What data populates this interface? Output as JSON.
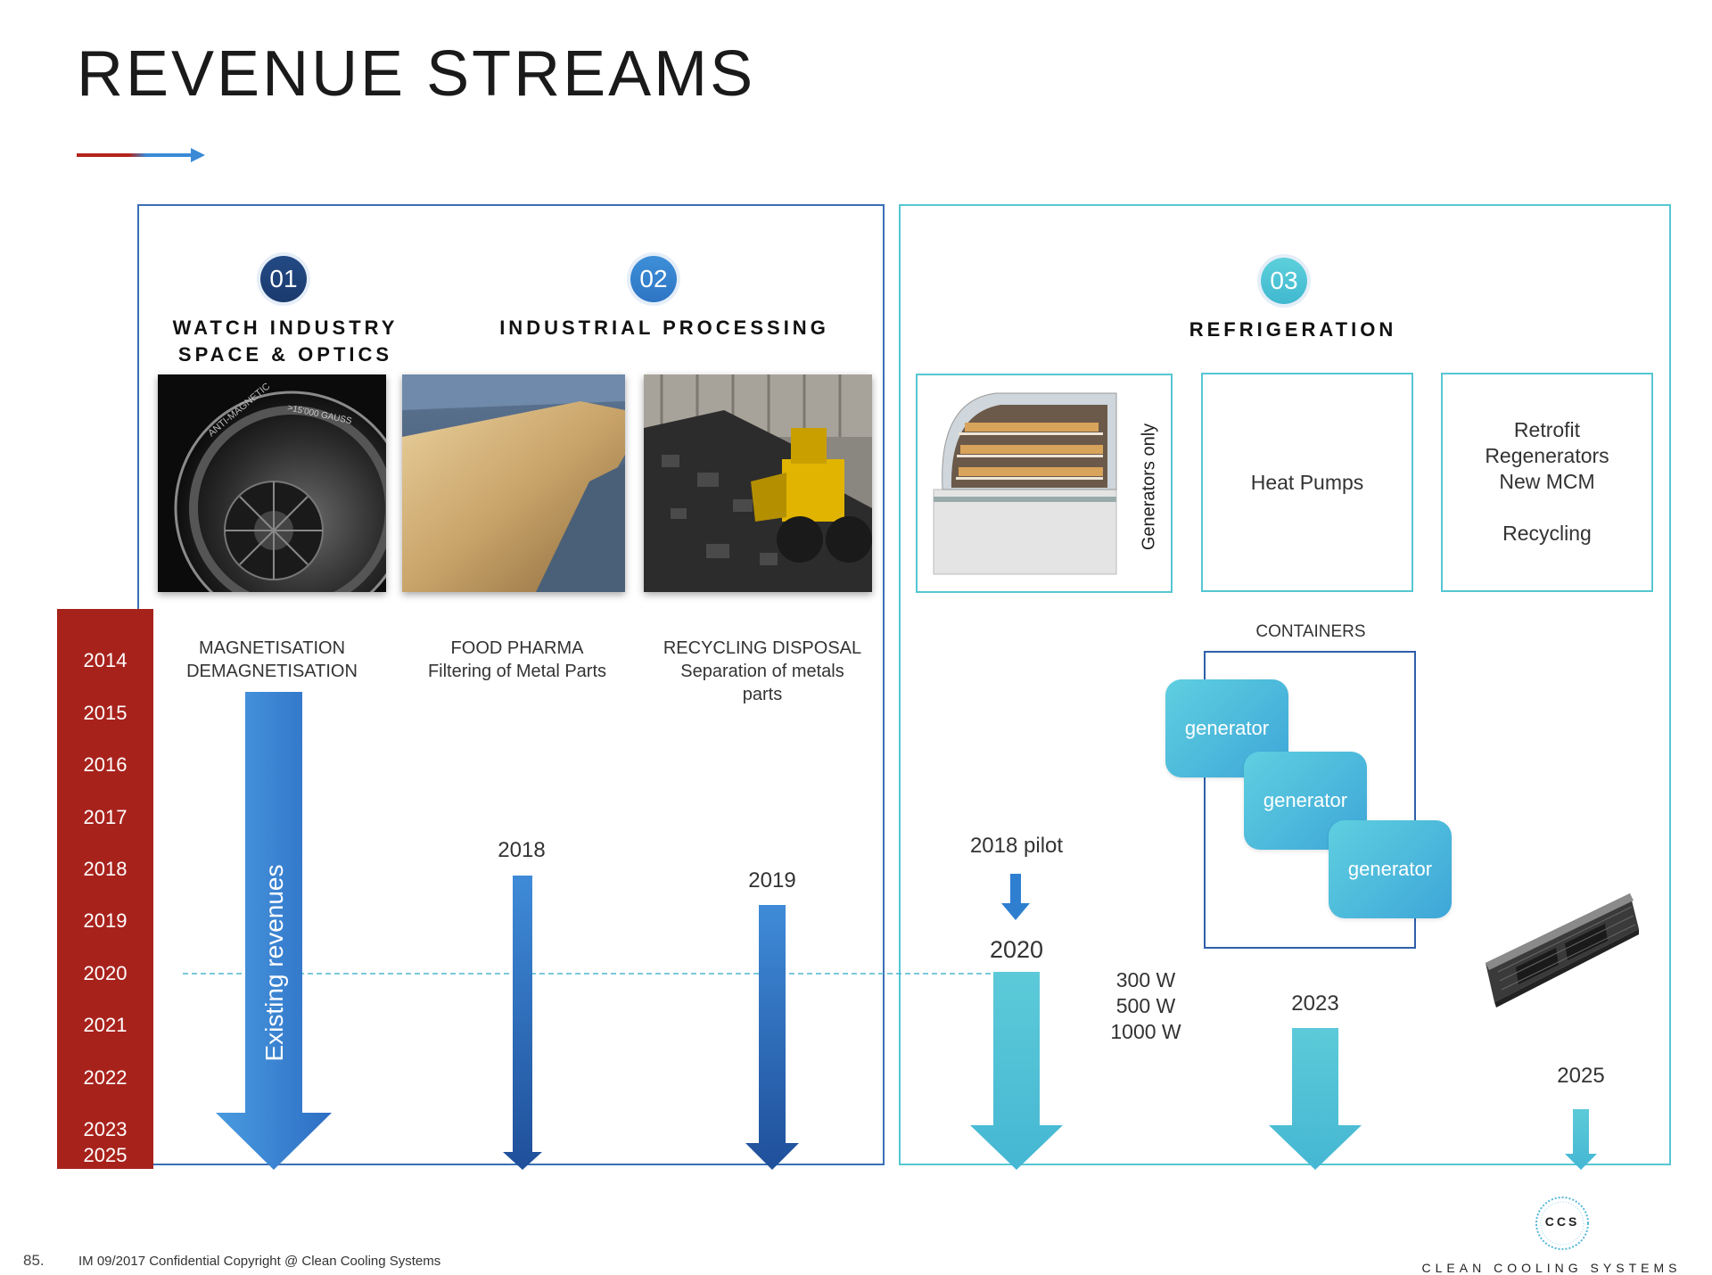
{
  "title": "REVENUE STREAMS",
  "colors": {
    "red": "#a8221c",
    "blue_dark": "#2f6cc0",
    "blue": "#3a8ad6",
    "cyan": "#55c7d2"
  },
  "sections": [
    {
      "number": "01",
      "heading_lines": [
        "WATCH INDUSTRY",
        "SPACE & OPTICS"
      ]
    },
    {
      "number": "02",
      "heading_lines": [
        "INDUSTRIAL PROCESSING"
      ]
    },
    {
      "number": "03",
      "heading_lines": [
        "REFRIGERATION"
      ]
    }
  ],
  "captions": [
    {
      "lines": [
        "MAGNETISATION",
        "DEMAGNETISATION"
      ]
    },
    {
      "lines": [
        "FOOD PHARMA",
        "Filtering of Metal Parts"
      ]
    },
    {
      "lines": [
        "RECYCLING DISPOSAL",
        "Separation of metals",
        "parts"
      ]
    }
  ],
  "years": [
    "2014",
    "2015",
    "2016",
    "2017",
    "2018",
    "2019",
    "2020",
    "2021",
    "2022",
    "2023",
    "2025"
  ],
  "arrows": {
    "existing_label": "Existing revenues",
    "food_year": "2018",
    "recycling_year": "2019",
    "pilot_label": "2018 pilot",
    "refrigeration_year": "2020",
    "containers_year": "2023",
    "mcm_year": "2025"
  },
  "refrigeration": {
    "generators_only": "Generators only",
    "heat_pumps": "Heat Pumps",
    "retrofit_lines": [
      "Retrofit",
      "Regenerators",
      "New MCM",
      "",
      "Recycling"
    ],
    "power_lines": [
      "300 W",
      "500 W",
      "1000 W"
    ],
    "containers_label": "CONTAINERS",
    "generator_label": "generator"
  },
  "photo_labels": {
    "watch_text": "ANTI-MAGNETIC",
    "watch_gauss": ">15'000 GAUSS"
  },
  "footer": {
    "page_number": "85.",
    "copyright": "IM 09/2017 Confidential Copyright @ Clean Cooling Systems",
    "logo_mark": "CCS",
    "logo_text": "CLEAN COOLING SYSTEMS"
  }
}
